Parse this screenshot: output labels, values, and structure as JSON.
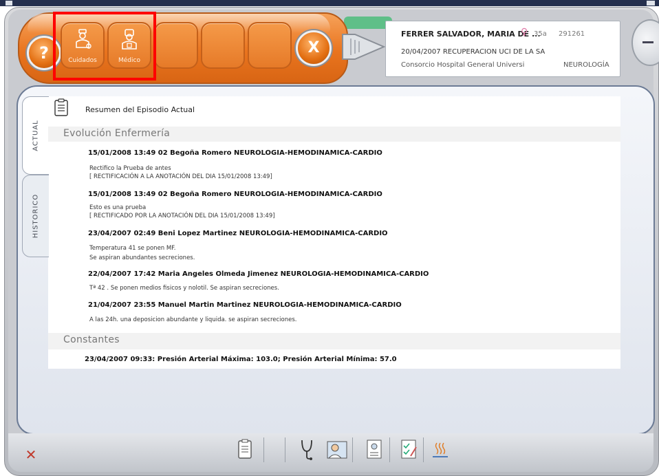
{
  "toolbar": {
    "help_label": "?",
    "close_label": "X",
    "buttons": [
      {
        "label": "Cuidados",
        "icon": "nurse-icon"
      },
      {
        "label": "Médico",
        "icon": "doctor-icon"
      }
    ]
  },
  "patient": {
    "name": "FERRER SALVADOR, MARIA DE ...",
    "gender_icon": "female-icon",
    "age": "35a",
    "record_number": "291261",
    "admission": "20/04/2007  RECUPERACION UCI DE LA SA",
    "hospital": "Consorcio Hospital General Universi",
    "department": "NEUROLOGÍA"
  },
  "tabs": {
    "actual": "ACTUAL",
    "historico": "HISTORICO"
  },
  "summary_title": "Resumen del Episodio Actual",
  "sections": {
    "evolucion": "Evolución Enfermería",
    "constantes": "Constantes"
  },
  "entries": [
    {
      "header": "15/01/2008 13:49 02 Begoña Romero NEUROLOGIA-HEMODINAMICA-CARDIO",
      "lines": [
        "Rectifico la Prueba de antes",
        "[ RECTIFICACIÓN A LA ANOTACIÓN DEL DIA 15/01/2008 13:49]"
      ]
    },
    {
      "header": "15/01/2008 13:49 02 Begoña Romero NEUROLOGIA-HEMODINAMICA-CARDIO",
      "lines": [
        "Esto es una prueba",
        "[ RECTIFICADO POR LA ANOTACIÓN DEL DIA 15/01/2008 13:49]"
      ]
    },
    {
      "header": "23/04/2007 02:49  Beni Lopez Martinez NEUROLOGIA-HEMODINAMICA-CARDIO",
      "lines": [
        "Temperatura 41 se ponen MF.",
        "Se aspiran abundantes secreciones."
      ]
    },
    {
      "header": "22/04/2007 17:42  Maria Angeles Olmeda Jimenez NEUROLOGIA-HEMODINAMICA-CARDIO",
      "lines": [
        "Tª 42 . Se ponen medios fisicos y nolotil. Se aspiran secreciones."
      ]
    },
    {
      "header": "21/04/2007 23:55  Manuel Martin Martinez NEUROLOGIA-HEMODINAMICA-CARDIO",
      "lines": [
        "A las 24h. una deposicion abundante y liquida. se aspiran secreciones."
      ]
    }
  ],
  "constantes": [
    "23/04/2007 09:33: Presión Arterial Máxima: 103.0; Presión Arterial Mínima: 57.0"
  ],
  "bottom_icons": [
    "clipboard-icon",
    "stethoscope-icon",
    "doctor-photo-icon",
    "patient-card-icon",
    "checklist-icon",
    "heat-icon"
  ],
  "colors": {
    "accent_orange": "#e9741e",
    "highlight": "#ff0000",
    "frame_blue": "#6c7b95"
  }
}
